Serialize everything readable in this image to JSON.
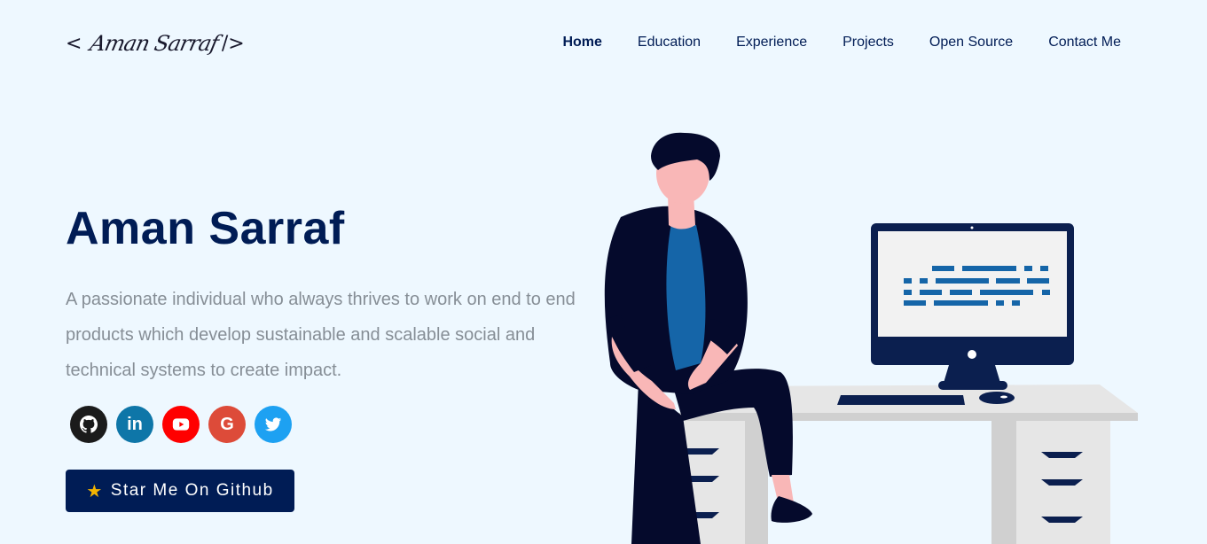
{
  "header": {
    "logo": {
      "open": "<",
      "signature": "Aman Sarraf",
      "close": "/>"
    },
    "nav": [
      {
        "label": "Home",
        "icon": ""
      },
      {
        "label": "Education"
      },
      {
        "label": "Experience"
      },
      {
        "label": "Projects"
      },
      {
        "label": "Open Source"
      },
      {
        "label": "Contact Me"
      }
    ]
  },
  "hero": {
    "name": "Aman Sarraf",
    "bio": "A passionate individual who always thrives to work on end to end products which develop sustainable and scalable social and technical systems to create impact.",
    "socials": [
      {
        "icon": "github-icon",
        "color": "#1b1b1b"
      },
      {
        "icon": "linkedin-icon",
        "color": "#0e76a8",
        "glyph": "in"
      },
      {
        "icon": "youtube-icon",
        "color": "#ff0000"
      },
      {
        "icon": "google-icon",
        "color": "#dd4b39",
        "glyph": "G"
      },
      {
        "icon": "twitter-icon",
        "color": "#1da1f2"
      }
    ],
    "cta": {
      "label": "Star Me On Github",
      "icon": "star-icon",
      "star": "★"
    }
  },
  "colors": {
    "accent": "#001c55",
    "background": "#eef8ff",
    "text_muted": "#868e96"
  }
}
